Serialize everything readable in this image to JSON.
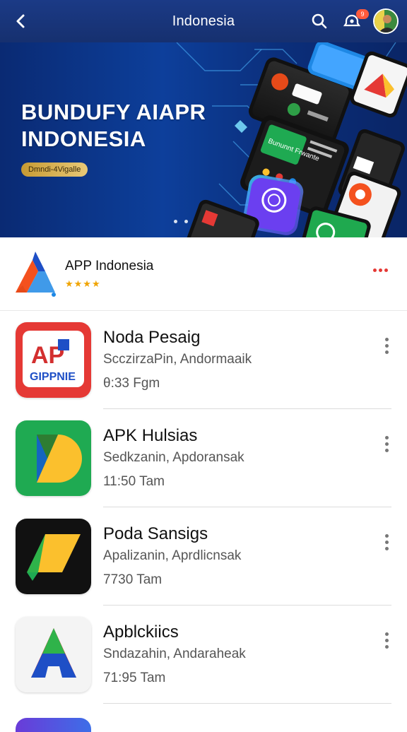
{
  "header": {
    "title": "Indonesia",
    "notification_count": "9",
    "icons": [
      "back-arrow-icon",
      "search-icon",
      "notification-icon",
      "avatar"
    ]
  },
  "banner": {
    "headline_line1": "BUNDUFY AIAPR",
    "headline_line2": "INDONESIA",
    "pill_text": "Dmndi-4Vigalle",
    "phone_label": "Bununnt Frwante"
  },
  "featured": {
    "name": "APP Indonesia",
    "stars": "★★★★"
  },
  "apps": [
    {
      "name": "Noda Pesaig",
      "subtitle": "ScczirzaPin, Andormaaik",
      "time": "θ:33 Fgm",
      "icon_text_top": "AP",
      "icon_text_bottom": "GIPPNIE"
    },
    {
      "name": "APK Hulsias",
      "subtitle": "Sedkzanin, Apdoransak",
      "time": "11:50 Tam"
    },
    {
      "name": "Poda Sansigs",
      "subtitle": "Apalizanin, Aprdlicnsak",
      "time": "7730 Tam"
    },
    {
      "name": "Apblckiics",
      "subtitle": "Sndazahin, Andaraheak",
      "time": "71:95 Tam"
    }
  ],
  "colors": {
    "topbar": "#1b3a86",
    "banner": "#0d3f9b",
    "star": "#f0a400",
    "menu_dots_red": "#e53935"
  }
}
